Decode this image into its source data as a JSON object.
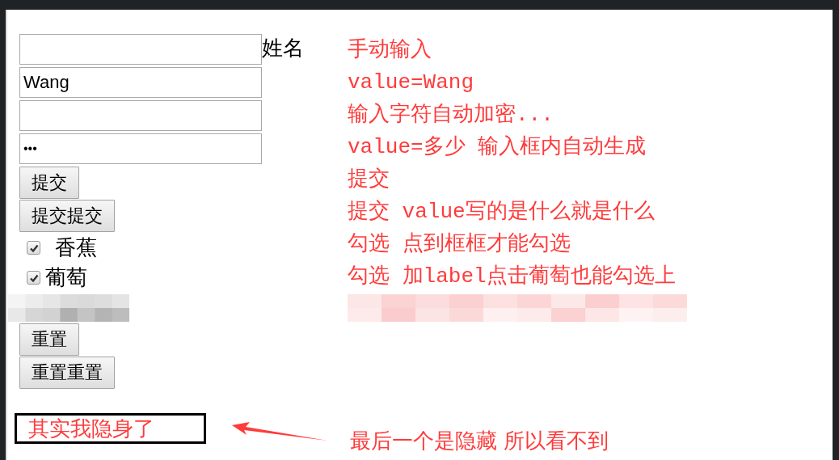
{
  "form": {
    "fields": [
      {
        "kind": "text",
        "label": "姓名"
      },
      {
        "kind": "text",
        "value": "Wang"
      },
      {
        "kind": "password"
      },
      {
        "kind": "password",
        "value": "•••"
      }
    ],
    "submit_buttons": [
      "提交",
      "提交提交"
    ],
    "checkboxes": [
      {
        "label": "香蕉",
        "checked": true
      },
      {
        "label": "葡萄",
        "checked": true
      }
    ],
    "reset_buttons": [
      "重置",
      "重置重置"
    ],
    "hidden_box": "其实我隐身了"
  },
  "notes": [
    "手动输入",
    "value=Wang",
    "输入字符自动加密...",
    "value=多少 输入框内自动生成",
    "提交",
    "提交 value写的是什么就是什么",
    "勾选 点到框框才能勾选",
    "勾选 加label点击葡萄也能勾选上"
  ],
  "bottom_note": "最后一个是隐藏 所以看不到"
}
